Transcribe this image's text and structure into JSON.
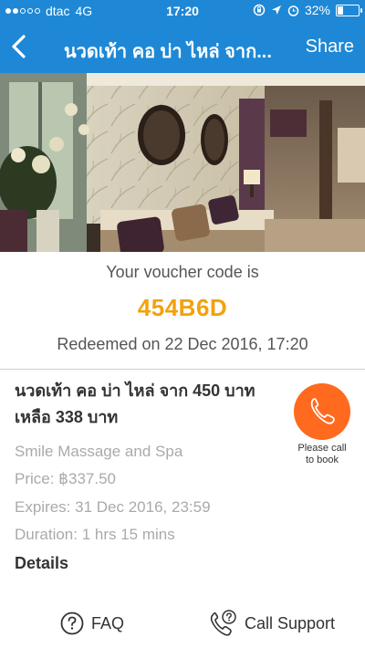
{
  "status_bar": {
    "carrier": "dtac",
    "network": "4G",
    "time": "17:20",
    "battery": "32%",
    "battery_level": 0.32
  },
  "nav": {
    "title": "นวดเท้า คอ บ่า ไหล่ จาก...",
    "share_label": "Share"
  },
  "voucher": {
    "label": "Your voucher code is",
    "code": "454B6D",
    "redeemed": "Redeemed on 22 Dec 2016, 17:20"
  },
  "deal": {
    "title_line1": "นวดเท้า คอ บ่า ไหล่ จาก 450 บาท",
    "title_line2": "เหลือ 338 บาท",
    "merchant": "Smile Massage and Spa",
    "price": "Price: ฿337.50",
    "expires": "Expires: 31 Dec 2016, 23:59",
    "duration": "Duration: 1 hrs 15 mins",
    "details_label": "Details"
  },
  "call": {
    "label_line1": "Please call",
    "label_line2": "to book"
  },
  "footer": {
    "faq_label": "FAQ",
    "support_label": "Call Support"
  },
  "colors": {
    "nav_blue": "#1e88d6",
    "code_orange": "#f2a20c",
    "call_orange": "#ff6a1f"
  }
}
